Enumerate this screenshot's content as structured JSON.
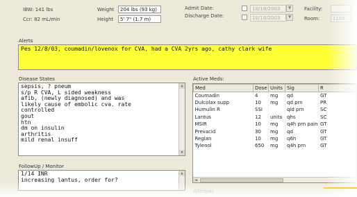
{
  "header": {
    "ibw_label": "IBW: 141 lbs",
    "ccr_label": "Ccr: 82 mL/min",
    "weight_label": "Weight",
    "weight_value": "204 lbs (93 kg)",
    "height_label": "Height",
    "height_value": "5' 7\" (1.7 m)",
    "admit_label": "Admit Date:",
    "admit_value": "10/18/2003",
    "discharge_label": "Discharge Date:",
    "discharge_value": "10/18/2003",
    "facility_label": "Facility:",
    "room_label": "Room:",
    "room_value": "1168"
  },
  "alerts": {
    "title": "Alerts",
    "text": "Pes 12/8/03, coumadin/lovenox for CVA, had a CVA 2yrs ago, cathy clark wife"
  },
  "disease_states": {
    "title": "Disease States",
    "lines": [
      "sepsis, ? pneum",
      "s/p R CVA, L sided weakness",
      "afib, (newly diagnosed) and was",
      "likely cause of embolic cva. rate",
      "controlled",
      "gout",
      "htn",
      "dm on insulin",
      "arthritis",
      "mild renal insuff"
    ]
  },
  "followup": {
    "title": "FollowUp / Monitor",
    "lines": [
      "1/14 INR",
      "increasing lantus, order for?"
    ]
  },
  "active_meds": {
    "title": "Active Meds:",
    "columns": [
      "Med",
      "Dose",
      "Units",
      "Sig",
      "R"
    ],
    "rows": [
      [
        "Coumadin",
        "4",
        "mg",
        "qd",
        "GT"
      ],
      [
        "Dulcolax supp",
        "10",
        "mg",
        "qd prn",
        "PR"
      ],
      [
        "Humulin R",
        "SSI",
        "",
        "qid prn",
        "SC"
      ],
      [
        "Lantus",
        "12",
        "units",
        "qhs",
        "SC"
      ],
      [
        "MSIR",
        "10",
        "mg",
        "q4h prn pain",
        "GT"
      ],
      [
        "Prevacid",
        "30",
        "mg",
        "qd",
        "GT"
      ],
      [
        "Reglan",
        "10",
        "mg",
        "q6h",
        "GT"
      ],
      [
        "Tylenol",
        "650",
        "mg",
        "q4h prn",
        "GT"
      ]
    ]
  },
  "allergies": {
    "title": "Allergies"
  },
  "scroll_icons": {
    "up": "▲",
    "down": "▼",
    "left": "◄",
    "right": "►",
    "dropdown": "▼"
  }
}
